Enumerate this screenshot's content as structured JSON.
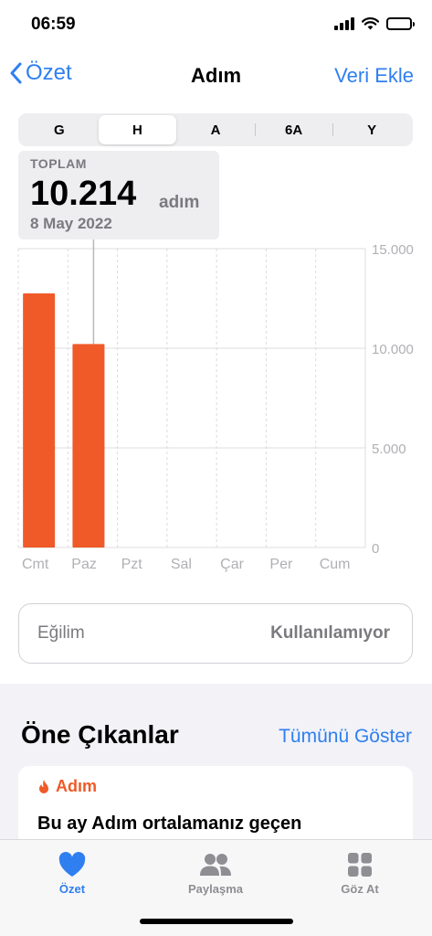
{
  "status_bar": {
    "time": "06:59"
  },
  "nav": {
    "back_label": "Özet",
    "title": "Adım",
    "action_label": "Veri Ekle"
  },
  "segments": [
    {
      "label": "G",
      "selected": false
    },
    {
      "label": "H",
      "selected": true
    },
    {
      "label": "A",
      "selected": false
    },
    {
      "label": "6A",
      "selected": false
    },
    {
      "label": "Y",
      "selected": false
    }
  ],
  "summary": {
    "label": "TOPLAM",
    "value": "10.214",
    "unit": "adım",
    "date": "8 May 2022"
  },
  "chart_data": {
    "type": "bar",
    "categories": [
      "Cmt",
      "Paz",
      "Pzt",
      "Sal",
      "Çar",
      "Per",
      "Cum"
    ],
    "values": [
      12750,
      10214,
      0,
      0,
      0,
      0,
      0
    ],
    "ylim": [
      0,
      15000
    ],
    "yticks": [
      0,
      5000,
      10000,
      15000
    ],
    "ytick_labels": [
      "0",
      "5.000",
      "10.000",
      "15.000"
    ],
    "selected_index": 1,
    "grid": true,
    "color": "#ef5a28"
  },
  "trend": {
    "label": "Eğilim",
    "value": "Kullanılamıyor"
  },
  "highlights": {
    "title": "Öne Çıkanlar",
    "action_label": "Tümünü Göster",
    "card": {
      "category": "Adım",
      "icon": "flame-icon",
      "message": "Bu ay Adım ortalamanız geçen"
    }
  },
  "tabbar": {
    "items": [
      {
        "label": "Özet",
        "icon": "heart-icon",
        "active": true
      },
      {
        "label": "Paylaşma",
        "icon": "people-icon",
        "active": false
      },
      {
        "label": "Göz At",
        "icon": "grid-icon",
        "active": false
      }
    ]
  },
  "colors": {
    "accent": "#2f7ff0",
    "bar": "#ef5a28",
    "muted": "#7a7a7f"
  }
}
